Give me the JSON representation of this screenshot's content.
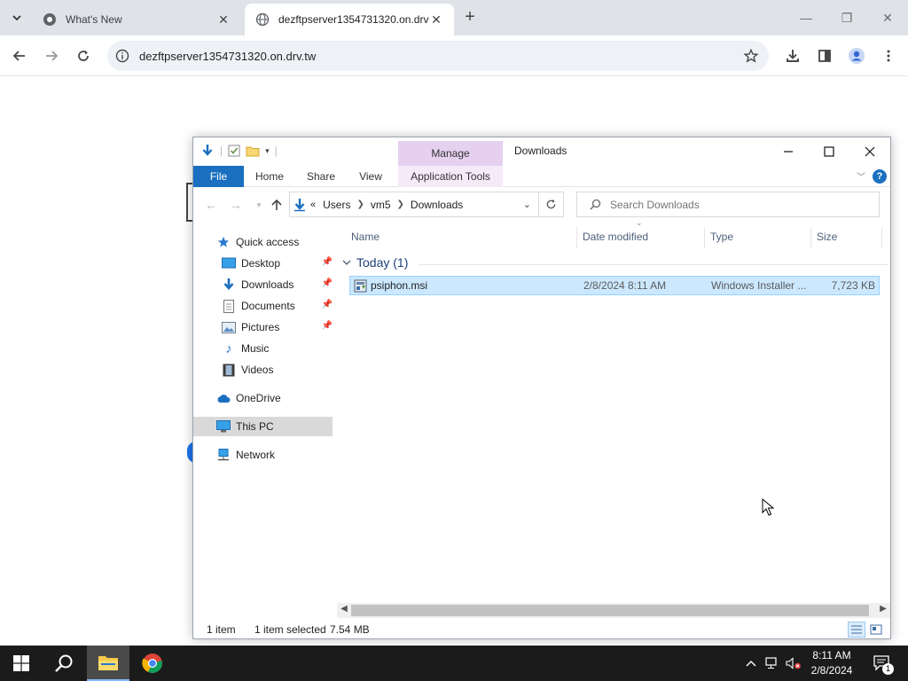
{
  "browser": {
    "tabs": [
      {
        "title": "What's New",
        "active": false
      },
      {
        "title": "dezftpserver1354731320.on.drv",
        "active": true
      }
    ],
    "url": "dezftpserver1354731320.on.drv.tw"
  },
  "explorer": {
    "title": "Downloads",
    "manage_label": "Manage",
    "ribbon_tabs": [
      "File",
      "Home",
      "Share",
      "View",
      "Application Tools"
    ],
    "address": {
      "prefix": "«",
      "segments": [
        "Users",
        "vm5",
        "Downloads"
      ]
    },
    "search_placeholder": "Search Downloads",
    "nav": {
      "quick_access": "Quick access",
      "items": [
        "Desktop",
        "Downloads",
        "Documents",
        "Pictures",
        "Music",
        "Videos"
      ],
      "onedrive": "OneDrive",
      "this_pc": "This PC",
      "network": "Network"
    },
    "columns": [
      "Name",
      "Date modified",
      "Type",
      "Size"
    ],
    "group": "Today (1)",
    "file": {
      "name": "psiphon.msi",
      "date": "2/8/2024 8:11 AM",
      "type": "Windows Installer ...",
      "size": "7,723 KB"
    },
    "status": {
      "count": "1 item",
      "selected": "1 item selected",
      "size": "7.54 MB"
    }
  },
  "taskbar": {
    "time": "8:11 AM",
    "date": "2/8/2024",
    "notification_count": "1"
  },
  "colors": {
    "accent": "#1a6fc0",
    "selection": "#cce8ff",
    "manage_band": "#e6d0ef",
    "taskbar": "#1b1b1b"
  }
}
